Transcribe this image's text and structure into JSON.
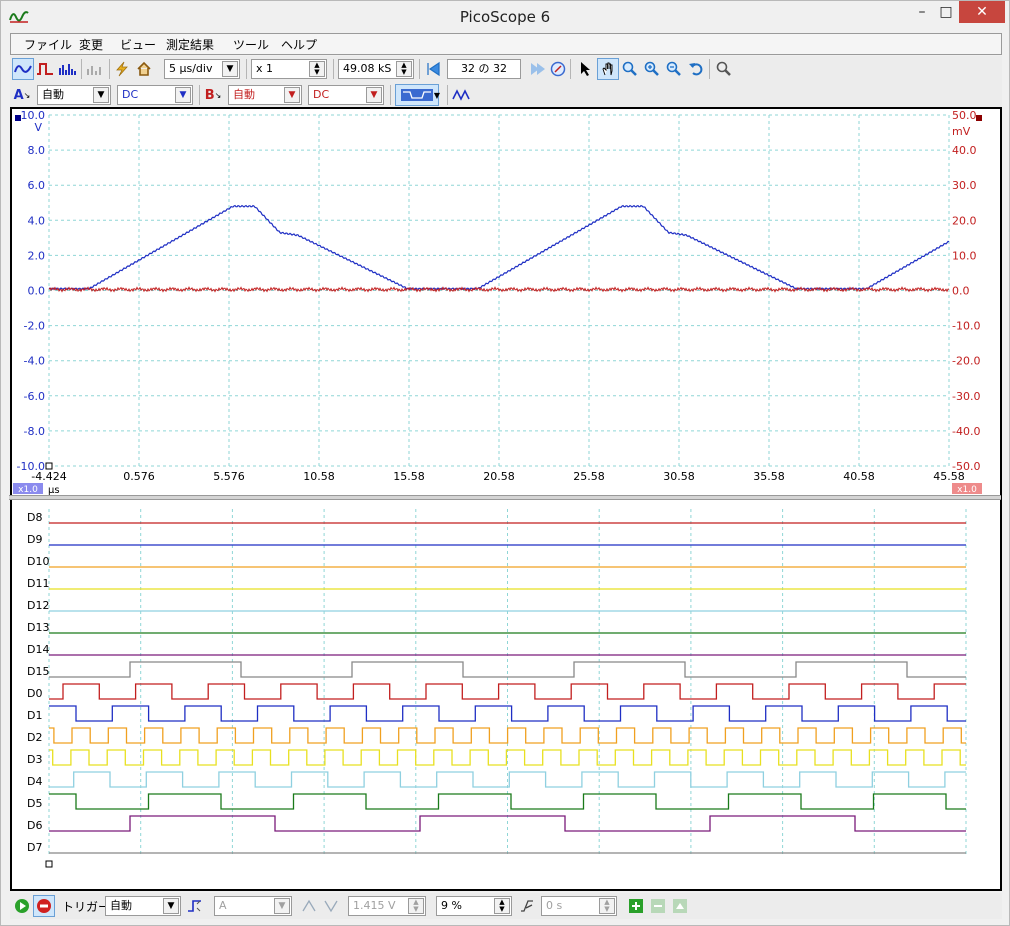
{
  "window": {
    "title": "PicoScope 6",
    "min": "–",
    "max": "□",
    "close": "✕"
  },
  "menu": [
    "ファイル",
    "変更",
    "ビュー",
    "測定結果",
    "ツール",
    "ヘルプ"
  ],
  "toolbar1": {
    "timebase": "5 µs/div",
    "zoom": "x 1",
    "samples": "49.08 kS",
    "buffer": "32 の 32"
  },
  "toolbar2": {
    "chA_label": "A",
    "chA_range": "自動",
    "chA_coupling": "DC",
    "chB_label": "B",
    "chB_range": "自動",
    "chB_coupling": "DC"
  },
  "analog": {
    "left_axis": {
      "unit": "V",
      "ticks": [
        "10.0",
        "8.0",
        "6.0",
        "4.0",
        "2.0",
        "0.0",
        "-2.0",
        "-4.0",
        "-6.0",
        "-8.0",
        "-10.0"
      ]
    },
    "right_axis": {
      "unit": "mV",
      "ticks": [
        "50.0",
        "40.0",
        "30.0",
        "20.0",
        "10.0",
        "0.0",
        "-10.0",
        "-20.0",
        "-30.0",
        "-40.0",
        "-50.0"
      ]
    },
    "x_ticks": [
      "-4.424",
      "0.576",
      "5.576",
      "10.58",
      "15.58",
      "20.58",
      "25.58",
      "30.58",
      "35.58",
      "40.58",
      "45.58"
    ],
    "x_unit": "µs",
    "left_scale_badge": "x1.0",
    "right_scale_badge": "x1.0",
    "colors": {
      "chA": "#1f2fc4",
      "chB": "#c21f1f",
      "grid": "#8fd6d6"
    }
  },
  "digital": {
    "channels": [
      {
        "name": "D8",
        "color": "#c21f1f"
      },
      {
        "name": "D9",
        "color": "#1f2fc4"
      },
      {
        "name": "D10",
        "color": "#f0a020"
      },
      {
        "name": "D11",
        "color": "#e8e020"
      },
      {
        "name": "D12",
        "color": "#8fd0e0"
      },
      {
        "name": "D13",
        "color": "#1a7a1a"
      },
      {
        "name": "D14",
        "color": "#7a1a7a"
      },
      {
        "name": "D15",
        "color": "#888888"
      },
      {
        "name": "D0",
        "color": "#c21f1f"
      },
      {
        "name": "D1",
        "color": "#1f2fc4"
      },
      {
        "name": "D2",
        "color": "#f0a020"
      },
      {
        "name": "D3",
        "color": "#e8e020"
      },
      {
        "name": "D4",
        "color": "#8fd0e0"
      },
      {
        "name": "D5",
        "color": "#1a7a1a"
      },
      {
        "name": "D6",
        "color": "#7a1a7a"
      },
      {
        "name": "D7",
        "color": "#888888"
      }
    ]
  },
  "statusbar": {
    "trigger_label": "トリガー",
    "trigger_mode": "自動",
    "trigger_source": "A",
    "threshold": "1.415 V",
    "pretrigger": "9 %",
    "delay": "0 s"
  }
}
